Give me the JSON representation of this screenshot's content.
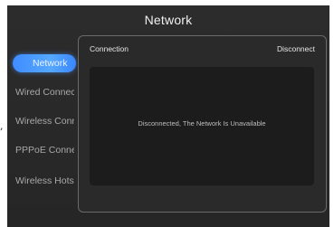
{
  "header": {
    "title": "Network"
  },
  "sidebar": {
    "items": [
      {
        "label": "Network"
      },
      {
        "label": "Wired Connection"
      },
      {
        "label": "Wireless Connection"
      },
      {
        "label": "PPPoE Connection"
      },
      {
        "label": "Wireless Hotspot"
      }
    ],
    "active_index": 0
  },
  "panel": {
    "heading": "Connection",
    "action_label": "Disconnect",
    "message": "Disconnected, The Network Is Unavailable"
  },
  "stray_glyph": ",",
  "colors": {
    "accent": "#4a98ff",
    "background": "#2a2a2a",
    "panel_border": "#6a6a6a"
  }
}
